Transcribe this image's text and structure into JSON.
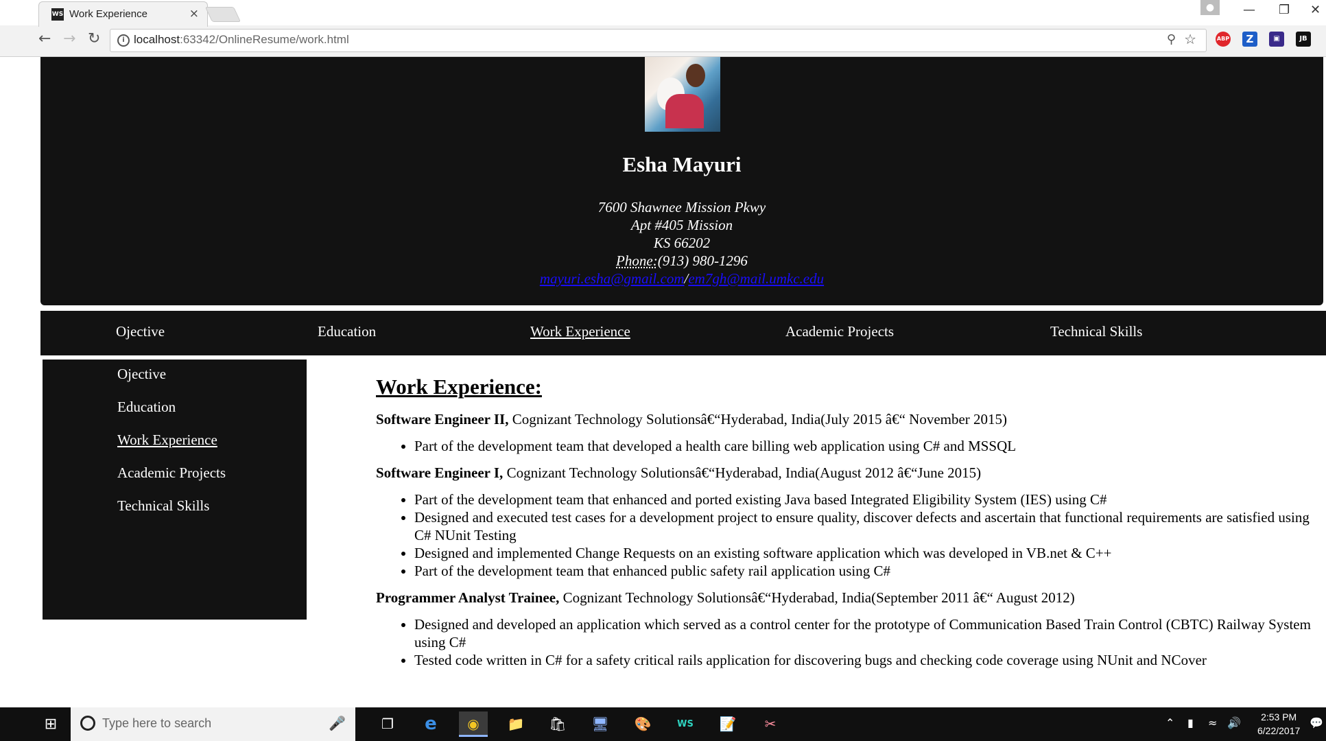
{
  "browser": {
    "tab_title": "Work Experience",
    "tab_favicon": "WS",
    "tab_close": "×",
    "url_host": "localhost",
    "url_path": ":63342/OnlineResume/work.html",
    "ext_abp": "ABP",
    "ext_zotero": "Z",
    "ext_jb": "JB"
  },
  "header": {
    "name": "Esha Mayuri",
    "address_line1": "7600 Shawnee Mission Pkwy",
    "address_line2": "Apt #405 Mission",
    "address_line3": "KS 66202",
    "phone_label": "Phone:",
    "phone": "(913) 980-1296",
    "email1": "mayuri.esha@gmail.com",
    "email_sep": "/",
    "email2": "em7gh@mail.umkc.edu"
  },
  "nav": {
    "items": [
      {
        "label": "Ojective"
      },
      {
        "label": "Education"
      },
      {
        "label": "Work Experience"
      },
      {
        "label": "Academic Projects"
      },
      {
        "label": "Technical Skills"
      }
    ],
    "active_index": 2
  },
  "main": {
    "title": "Work Experience:",
    "jobs": [
      {
        "role": "Software Engineer II,",
        "details": "Cognizant Technology Solutionsâ€“Hyderabad, India(July 2015 â€“ November 2015)",
        "bullets": [
          "Part of the development team that developed a health care billing web application using C# and MSSQL"
        ]
      },
      {
        "role": "Software Engineer I,",
        "details": "Cognizant Technology Solutionsâ€“Hyderabad, India(August 2012 â€“June 2015)",
        "bullets": [
          "Part of the development team that enhanced and ported existing Java based Integrated Eligibility System (IES) using C#",
          "Designed and executed test cases for a development project to ensure quality, discover defects and ascertain that functional requirements are satisfied using C# NUnit Testing",
          "Designed and implemented Change Requests on an existing software application which was developed in VB.net & C++",
          "Part of the development team that enhanced public safety rail application using C#"
        ]
      },
      {
        "role": "Programmer Analyst Trainee,",
        "details": "Cognizant Technology Solutionsâ€“Hyderabad, India(September 2011 â€“ August 2012)",
        "bullets": [
          "Designed and developed an application which served as a control center for the prototype of Communication Based Train Control (CBTC) Railway System using C#",
          "Tested code written in C# for a safety critical rails application for discovering bugs and checking code coverage using NUnit and NCover"
        ]
      }
    ]
  },
  "taskbar": {
    "search_placeholder": "Type here to search",
    "time": "2:53 PM",
    "date": "6/22/2017",
    "ws_label": "WS"
  },
  "colors": {
    "header_bg": "#121212",
    "link": "#1a0dff"
  }
}
